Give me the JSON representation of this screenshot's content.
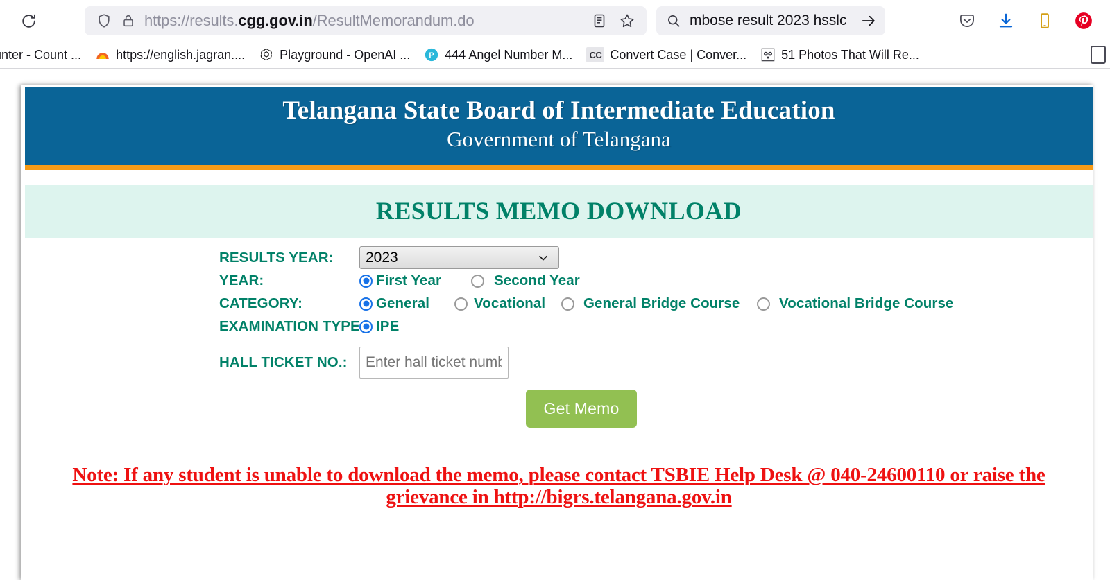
{
  "browser": {
    "reload_icon": "reload-icon",
    "shield_icon": "shield-icon",
    "lock_icon": "lock-icon",
    "url_prefix": "https://results.",
    "url_host": "cgg.gov.in",
    "url_path": "/ResultMemorandum.do",
    "reader_icon": "reader-view-icon",
    "bookmark_star_icon": "bookmark-star-icon",
    "search_icon": "search-icon",
    "search_query": "mbose result 2023 hsslc",
    "search_go_icon": "arrow-right-icon",
    "pocket_icon": "pocket-icon",
    "downloads_icon": "downloads-icon",
    "device_icon": "mobile-device-icon",
    "pinterest_icon": "pinterest-icon",
    "bookmarks": [
      {
        "label": "unter - Count ...",
        "icon": "generic-page-icon",
        "has_icon": false
      },
      {
        "label": "https://english.jagran....",
        "icon": "jagran-icon",
        "has_icon": true
      },
      {
        "label": "Playground - OpenAI ...",
        "icon": "openai-icon",
        "has_icon": true
      },
      {
        "label": "444 Angel Number M...",
        "icon": "p-circle-icon",
        "has_icon": true
      },
      {
        "label": "Convert Case | Conver...",
        "icon": "cc-icon",
        "has_icon": true
      },
      {
        "label": "51 Photos That Will Re...",
        "icon": "owl-icon",
        "has_icon": true
      }
    ]
  },
  "site": {
    "title": "Telangana State Board of Intermediate Education",
    "subtitle": "Government of Telangana",
    "banner_title": "RESULTS MEMO DOWNLOAD"
  },
  "form": {
    "results_year_label": "RESULTS YEAR:",
    "results_year_value": "2023",
    "results_year_options": [
      "2023"
    ],
    "year_label": "YEAR:",
    "year_options": [
      {
        "label": "First Year",
        "selected": true
      },
      {
        "label": "Second Year",
        "selected": false
      }
    ],
    "category_label": "CATEGORY:",
    "category_options": [
      {
        "label": "General",
        "selected": true
      },
      {
        "label": "Vocational",
        "selected": false
      },
      {
        "label": "General Bridge Course",
        "selected": false
      },
      {
        "label": "Vocational Bridge Course",
        "selected": false
      }
    ],
    "exam_type_label": "EXAMINATION TYPE :",
    "exam_type_options": [
      {
        "label": "IPE",
        "selected": true
      }
    ],
    "hall_ticket_label": "HALL TICKET NO.:",
    "hall_ticket_placeholder": "Enter hall ticket number",
    "hall_ticket_value": "",
    "submit_label": "Get Memo"
  },
  "note": {
    "text": "Note: If any student is unable to download the memo, please contact TSBIE Help Desk @ 040-24600110 or raise the grievance in http://bigrs.telangana.gov.in"
  },
  "colors": {
    "header_blue": "#0a6497",
    "orange_rule": "#f79b16",
    "banner_bg": "#ddf4ee",
    "teal_text": "#018168",
    "button_green": "#92c052",
    "note_red": "#ee1111",
    "radio_selected_blue": "#1872e8"
  }
}
